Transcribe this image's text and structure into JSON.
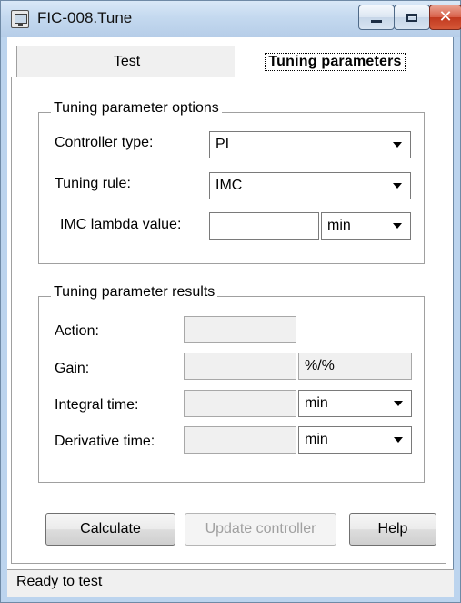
{
  "window": {
    "title": "FIC-008.Tune",
    "icon": "app-window-icon",
    "buttons": {
      "minimize": "minimize-icon",
      "maximize": "maximize-icon",
      "close": "close-icon"
    }
  },
  "tabs": [
    {
      "label": "Test",
      "selected": false
    },
    {
      "label": "Tuning parameters",
      "selected": true
    }
  ],
  "options": {
    "title": "Tuning parameter options",
    "controller_type": {
      "label": "Controller type:",
      "value": "PI"
    },
    "tuning_rule": {
      "label": "Tuning rule:",
      "value": "IMC"
    },
    "lambda": {
      "label": "IMC lambda value:",
      "value": "",
      "unit": "min"
    }
  },
  "results": {
    "title": "Tuning parameter results",
    "action": {
      "label": "Action:",
      "value": ""
    },
    "gain": {
      "label": "Gain:",
      "value": "",
      "unit": "%/%"
    },
    "integral": {
      "label": "Integral time:",
      "value": "",
      "unit": "min"
    },
    "derivative": {
      "label": "Derivative time:",
      "value": "",
      "unit": "min"
    }
  },
  "buttons": {
    "calculate": "Calculate",
    "update": "Update controller",
    "help": "Help"
  },
  "status": "Ready to test",
  "colors": {
    "titlebar": "#c4d9ef",
    "close": "#c1391f",
    "panel": "#f0f0f0"
  }
}
